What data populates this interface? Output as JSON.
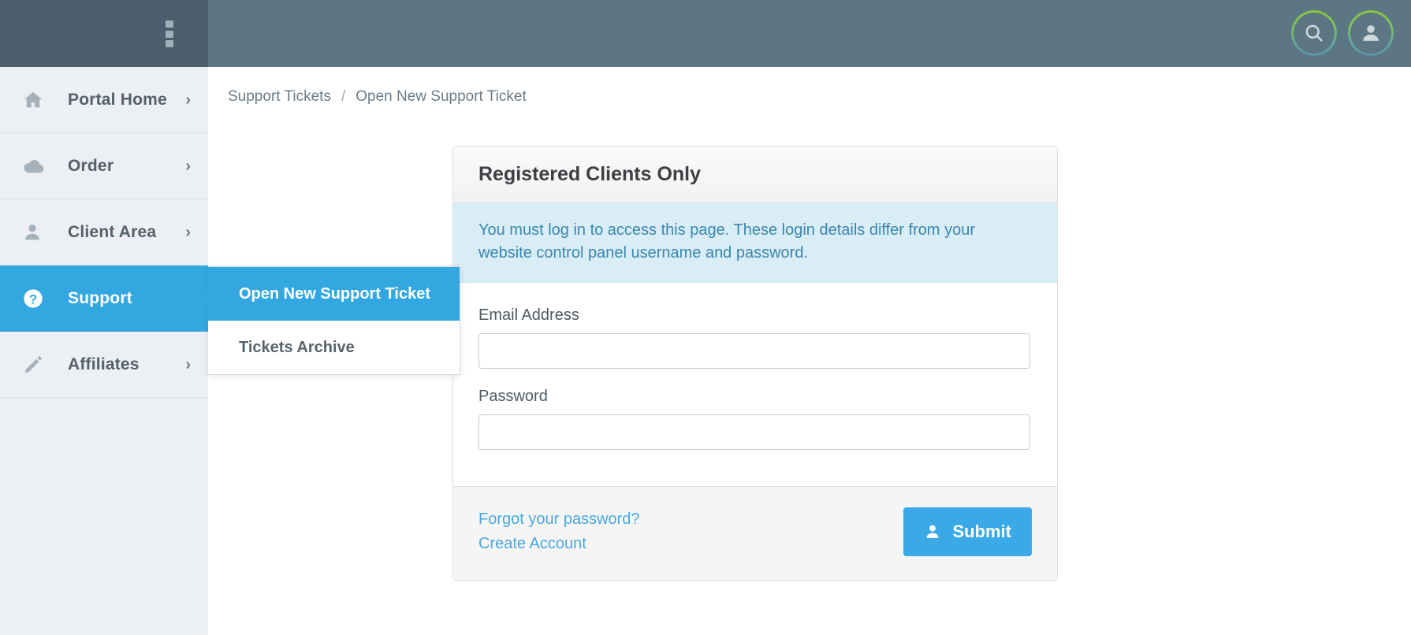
{
  "topbar": {
    "menu_toggle": "menu-toggle",
    "search_label": "Search",
    "account_label": "Account"
  },
  "sidebar": {
    "items": [
      {
        "label": "Portal Home",
        "icon": "home-icon",
        "chevron": "›",
        "active": false
      },
      {
        "label": "Order",
        "icon": "cloud-icon",
        "chevron": "›",
        "active": false
      },
      {
        "label": "Client Area",
        "icon": "user-icon",
        "chevron": "›",
        "active": false
      },
      {
        "label": "Support",
        "icon": "question-circle-icon",
        "chevron": "›",
        "active": true
      },
      {
        "label": "Affiliates",
        "icon": "pencil-icon",
        "chevron": "›",
        "active": false
      }
    ]
  },
  "submenu": {
    "items": [
      {
        "label": "Open New Support Ticket",
        "active": true
      },
      {
        "label": "Tickets Archive",
        "active": false
      }
    ]
  },
  "breadcrumb": {
    "parent": "Support Tickets",
    "separator": "/",
    "current": "Open New Support Ticket"
  },
  "panel": {
    "title": "Registered Clients Only",
    "alert": "You must log in to access this page. These login details differ from your website control panel username and password.",
    "fields": [
      {
        "label": "Email Address",
        "value": "",
        "placeholder": "",
        "type": "email"
      },
      {
        "label": "Password",
        "value": "",
        "placeholder": "",
        "type": "password"
      }
    ],
    "footer": {
      "forgot_password": "Forgot your password?",
      "create_account": "Create Account",
      "submit_label": "Submit"
    }
  },
  "colors": {
    "topbar": "#5c7683",
    "topbar_left": "#4a5f6b",
    "sidebar": "#eceff3",
    "accent": "#33a8e0",
    "alert_bg": "#d9edf7",
    "alert_text": "#3a87ad",
    "link": "#4aa8e0",
    "gradient_start": "#8dc63f",
    "gradient_end": "#5b92a8"
  }
}
